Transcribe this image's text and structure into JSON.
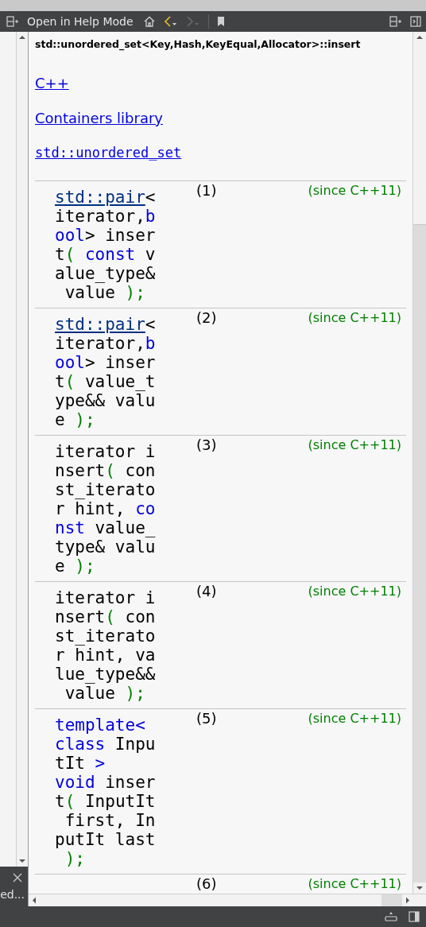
{
  "toolbar": {
    "title": "Open in Help Mode",
    "back_enabled": true,
    "forward_enabled": false
  },
  "left_panel": {
    "label": "ed..."
  },
  "page": {
    "heading": "std::unordered_set<Key,Hash,KeyEqual,Allocator>::insert",
    "breadcrumbs": [
      {
        "text": "C++",
        "kind": "link"
      },
      {
        "text": "Containers library",
        "kind": "link"
      },
      {
        "text": "std::unordered_set",
        "kind": "code-link"
      }
    ],
    "overloads": [
      {
        "number": "(1)",
        "since": "(since C++11)",
        "tokens": [
          {
            "kind": "link",
            "text": "std::pair"
          },
          {
            "kind": "text",
            "text": "<\niterator,"
          },
          {
            "kind": "kw",
            "text": "b\nool"
          },
          {
            "kind": "text",
            "text": "> inser\nt"
          },
          {
            "kind": "punct",
            "text": "( "
          },
          {
            "kind": "kw",
            "text": "const"
          },
          {
            "kind": "text",
            "text": " v\nalue_type&\n value "
          },
          {
            "kind": "punct",
            "text": ");"
          }
        ]
      },
      {
        "number": "(2)",
        "since": "(since C++11)",
        "tokens": [
          {
            "kind": "link",
            "text": "std::pair"
          },
          {
            "kind": "text",
            "text": "<\niterator,"
          },
          {
            "kind": "kw",
            "text": "b\nool"
          },
          {
            "kind": "text",
            "text": "> inser\nt"
          },
          {
            "kind": "punct",
            "text": "("
          },
          {
            "kind": "text",
            "text": " value_t\nype&& valu\ne "
          },
          {
            "kind": "punct",
            "text": ");"
          }
        ]
      },
      {
        "number": "(3)",
        "since": "(since C++11)",
        "tokens": [
          {
            "kind": "text",
            "text": "iterator i\nnsert"
          },
          {
            "kind": "punct",
            "text": "("
          },
          {
            "kind": "text",
            "text": " con\nst_iterato\nr hint, "
          },
          {
            "kind": "kw",
            "text": "co\nnst"
          },
          {
            "kind": "text",
            "text": " value_\ntype& valu\ne "
          },
          {
            "kind": "punct",
            "text": ");"
          }
        ]
      },
      {
        "number": "(4)",
        "since": "(since C++11)",
        "tokens": [
          {
            "kind": "text",
            "text": "iterator i\nnsert"
          },
          {
            "kind": "punct",
            "text": "("
          },
          {
            "kind": "text",
            "text": " con\nst_iterato\nr hint, va\nlue_type&&\n value "
          },
          {
            "kind": "punct",
            "text": ");"
          }
        ]
      },
      {
        "number": "(5)",
        "since": "(since C++11)",
        "tokens": [
          {
            "kind": "kw",
            "text": "template<"
          },
          {
            "kind": "kw",
            "text": "\nclass"
          },
          {
            "kind": "text",
            "text": " Inpu\ntIt "
          },
          {
            "kind": "kw",
            "text": ">"
          },
          {
            "kind": "kw",
            "text": "\nvoid"
          },
          {
            "kind": "text",
            "text": " inser\nt"
          },
          {
            "kind": "punct",
            "text": "("
          },
          {
            "kind": "text",
            "text": " InputIt\n first, In\nputIt last\n "
          },
          {
            "kind": "punct",
            "text": ");"
          }
        ]
      },
      {
        "number": "(6)",
        "since": "(since C++11)"
      }
    ]
  }
}
